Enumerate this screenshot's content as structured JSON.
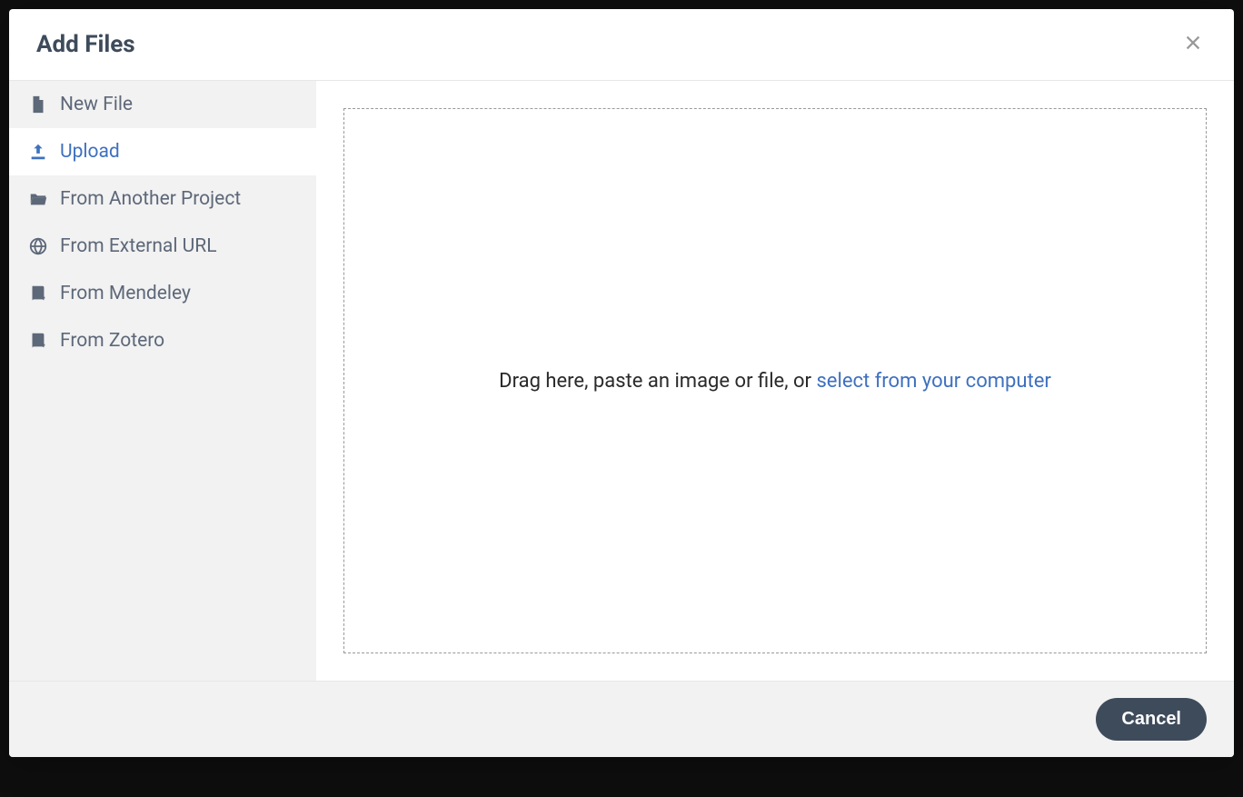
{
  "modal": {
    "title": "Add Files",
    "close_label": "×"
  },
  "sidebar": {
    "items": [
      {
        "label": "New File",
        "icon": "file-icon",
        "active": false
      },
      {
        "label": "Upload",
        "icon": "upload-icon",
        "active": true
      },
      {
        "label": "From Another Project",
        "icon": "folder-open-icon",
        "active": false
      },
      {
        "label": "From External URL",
        "icon": "globe-icon",
        "active": false
      },
      {
        "label": "From Mendeley",
        "icon": "book-icon",
        "active": false
      },
      {
        "label": "From Zotero",
        "icon": "book-icon",
        "active": false
      }
    ]
  },
  "dropzone": {
    "prefix_text": "Drag here, paste an image or file, or ",
    "link_text": "select from your computer"
  },
  "footer": {
    "cancel_label": "Cancel"
  }
}
